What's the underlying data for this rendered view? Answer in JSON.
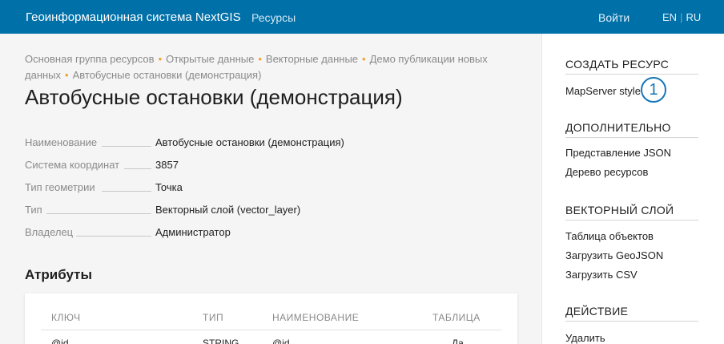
{
  "header": {
    "brand": "Геоинформационная система NextGIS",
    "nav_resources": "Ресурсы",
    "login": "Войти",
    "lang_en": "EN",
    "lang_ru": "RU"
  },
  "breadcrumbs": [
    "Основная группа ресурсов",
    "Открытые данные",
    "Векторные данные",
    "Демо публикации новых данных",
    "Автобусные остановки (демонстрация)"
  ],
  "page_title": "Автобусные остановки (демонстрация)",
  "properties": [
    {
      "key": "Наименование",
      "value": "Автобусные остановки (демонстрация)"
    },
    {
      "key": "Система координат",
      "value": "3857"
    },
    {
      "key": "Тип геометрии",
      "value": "Точка"
    },
    {
      "key": "Тип",
      "value": "Векторный слой (vector_layer)"
    },
    {
      "key": "Владелец",
      "value": "Администратор"
    }
  ],
  "attributes": {
    "title": "Атрибуты",
    "columns": [
      "КЛЮЧ",
      "ТИП",
      "НАИМЕНОВАНИЕ",
      "ТАБЛИЦА"
    ],
    "rows": [
      {
        "key": "@id",
        "type": "STRING",
        "name": "@id",
        "table": "Да"
      }
    ]
  },
  "sidebar": {
    "create_title": "СОЗДАТЬ РЕСУРС",
    "create_items": [
      "MapServer style"
    ],
    "extra_title": "ДОПОЛНИТЕЛЬНО",
    "extra_items": [
      "Представление JSON",
      "Дерево ресурсов"
    ],
    "vector_title": "ВЕКТОРНЫЙ СЛОЙ",
    "vector_items": [
      "Таблица объектов",
      "Загрузить GeoJSON",
      "Загрузить CSV"
    ],
    "action_title": "ДЕЙСТВИЕ",
    "action_items": [
      "Удалить"
    ]
  },
  "callout_number": "1",
  "colors": {
    "header_bg": "#0070a8",
    "breadcrumb_dot": "#f0a030",
    "callout": "#1677b8"
  }
}
